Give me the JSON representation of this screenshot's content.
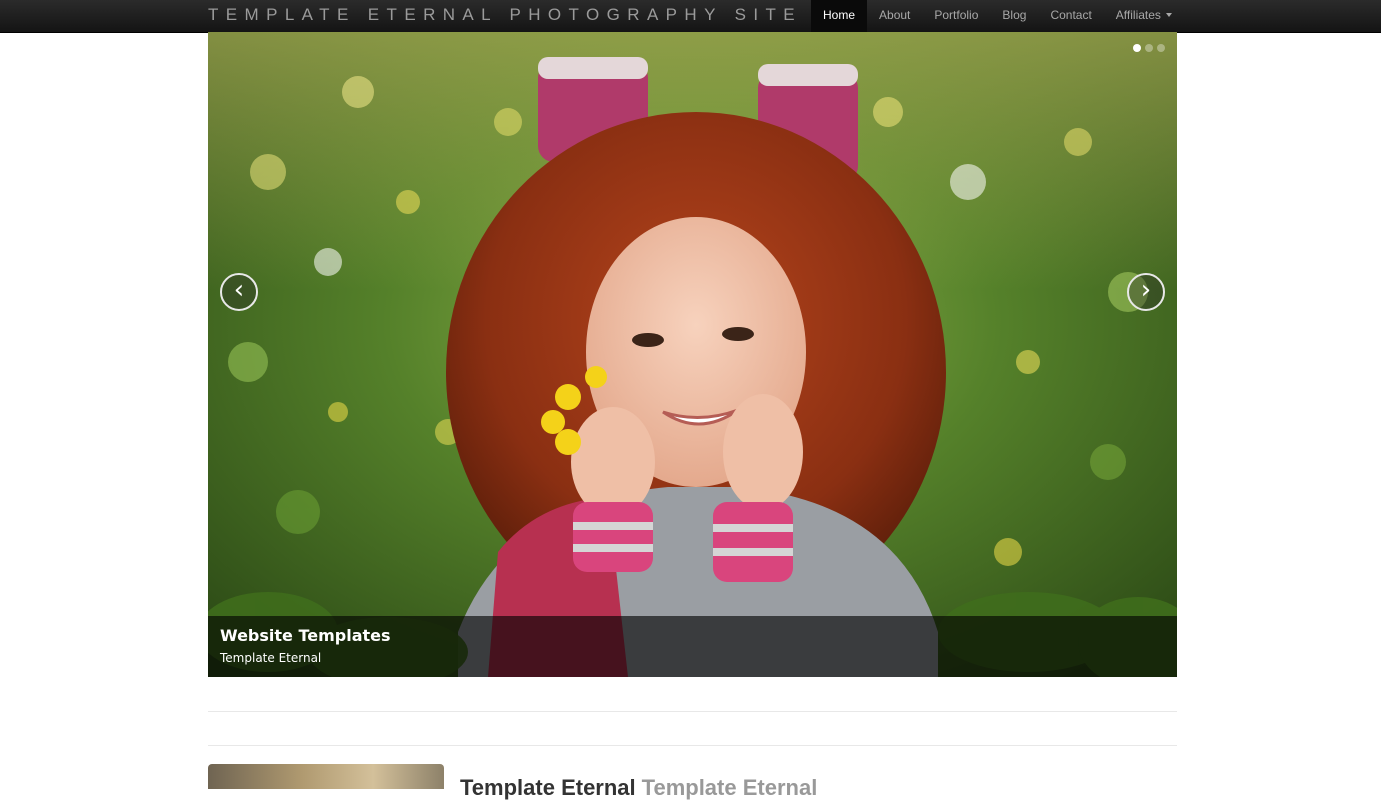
{
  "navbar": {
    "brand": "TEMPLATE ETERNAL PHOTOGRAPHY SITE",
    "items": [
      {
        "label": "Home",
        "active": true
      },
      {
        "label": "About"
      },
      {
        "label": "Portfolio"
      },
      {
        "label": "Blog"
      },
      {
        "label": "Contact"
      },
      {
        "label": "Affiliates",
        "dropdown": true
      }
    ]
  },
  "carousel": {
    "caption_title": "Website Templates",
    "caption_text": "Template Eternal",
    "slide_count": 3,
    "active_slide": 1,
    "prev_icon": "chevron-left-icon",
    "next_icon": "chevron-right-icon"
  },
  "featurette": {
    "title": "Template Eternal",
    "title_muted": "Template Eternal"
  },
  "colors": {
    "navbar_bg": "#1b1b1b",
    "active_nav_bg": "#0a0a0a",
    "caption_bg": "#000000"
  }
}
